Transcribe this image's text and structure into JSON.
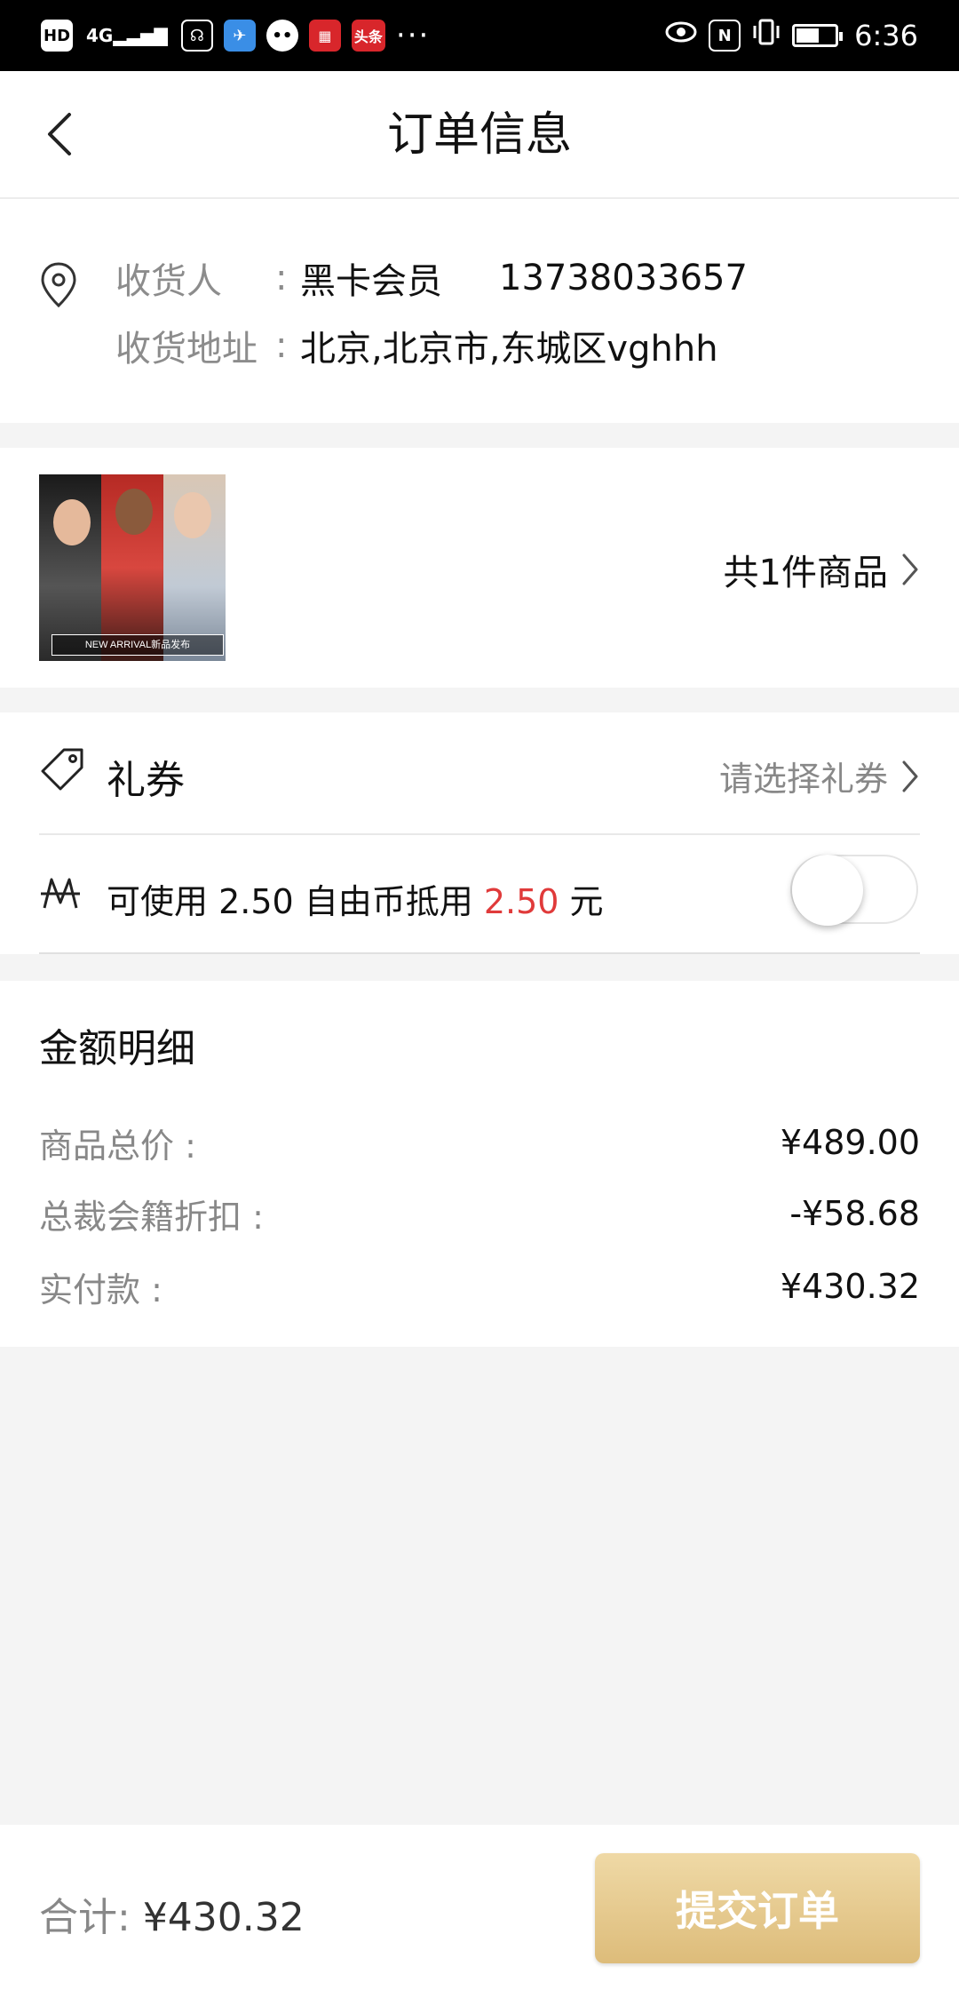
{
  "status_bar": {
    "hd": "HD",
    "network": "4G",
    "more": "···",
    "nfc": "N",
    "time": "6:36"
  },
  "header": {
    "title": "订单信息"
  },
  "address": {
    "receiver_label": "收货人",
    "colon": ":",
    "receiver_name": "黑卡会员",
    "receiver_phone": "13738033657",
    "address_label": "收货地址",
    "address_colon": ":",
    "address_value": "北京,北京市,东城区vghhh"
  },
  "goods": {
    "thumbnail_caption": "NEW ARRIVAL新品发布",
    "count_text": "共1件商品"
  },
  "coupon": {
    "label": "礼券",
    "choose_text": "请选择礼券"
  },
  "coins": {
    "icon_glyph": "M",
    "prefix": "可使用 2.50 自由币抵用 ",
    "amount": "2.50",
    "suffix": " 元",
    "toggle_on": false
  },
  "amount_detail": {
    "title": "金额明细",
    "rows": [
      {
        "label": "商品总价 :",
        "value": "¥489.00"
      },
      {
        "label": "总裁会籍折扣 :",
        "value": "-¥58.68"
      },
      {
        "label": "实付款 :",
        "value": "¥430.32"
      }
    ]
  },
  "footer": {
    "total_label": "合计: ",
    "total_value": "¥430.32",
    "submit_label": "提交订单"
  },
  "colors": {
    "accent_red": "#e03a3a",
    "submit_gold": "#ddbc7a"
  }
}
